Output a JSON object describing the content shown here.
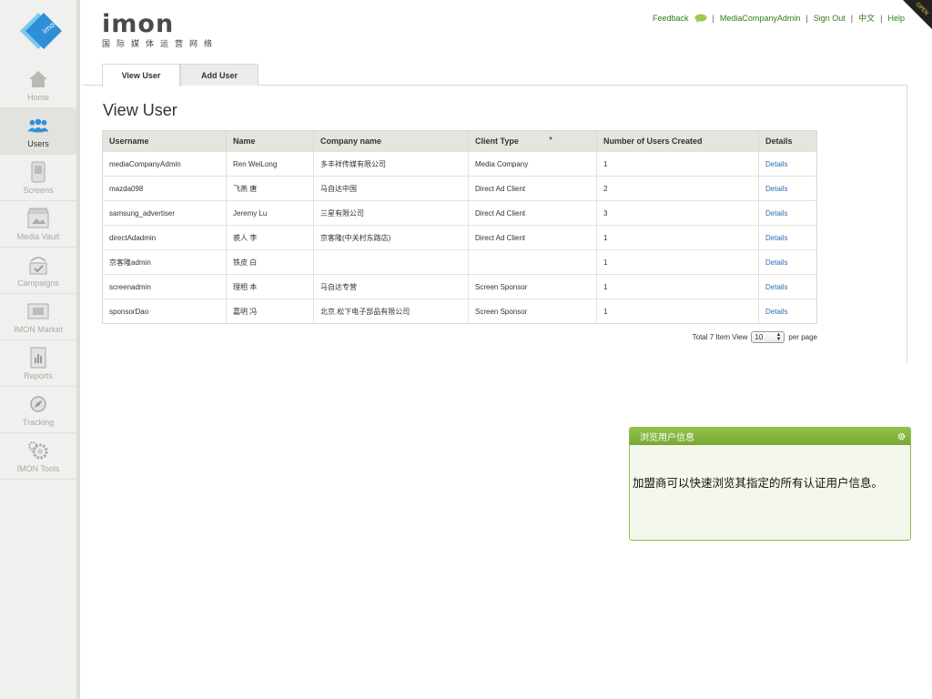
{
  "brand": {
    "name": "imon",
    "subtitle": "国际媒体运营网络"
  },
  "top_links": {
    "feedback": "Feedback",
    "user": "MediaCompanyAdmin",
    "sign_out": "Sign Out",
    "language": "中文",
    "help": "Help",
    "corner_badge": "OPEN"
  },
  "sidebar": {
    "items": [
      {
        "label": "Home",
        "icon": "home-icon"
      },
      {
        "label": "Users",
        "icon": "users-icon"
      },
      {
        "label": "Screens",
        "icon": "screen-icon"
      },
      {
        "label": "Media Vault",
        "icon": "media-vault-icon"
      },
      {
        "label": "Campaigns",
        "icon": "campaigns-icon"
      },
      {
        "label": "IMON Market",
        "icon": "market-icon"
      },
      {
        "label": "Reports",
        "icon": "reports-icon"
      },
      {
        "label": "Tracking",
        "icon": "tracking-icon"
      },
      {
        "label": "IMON Tools",
        "icon": "tools-icon"
      }
    ],
    "active": "Users"
  },
  "tabs": {
    "view_user": "View User",
    "add_user": "Add User",
    "active": "View User"
  },
  "page_title": "View User",
  "table": {
    "headers": [
      "Username",
      "Name",
      "Company name",
      "Client Type",
      "Number of Users Created",
      "Details"
    ],
    "rows": [
      [
        "mediaCompanyAdmin",
        "Ren  WeiLong",
        "多丰祥传媒有限公司",
        "Media Company",
        "1",
        "Details"
      ],
      [
        "mazda098",
        "飞燕  唐",
        "马自达中国",
        "Direct Ad Client",
        "2",
        "Details"
      ],
      [
        "samsung_advertiser",
        "Jeremy   Lu",
        "三星有限公司",
        "Direct Ad Client",
        "3",
        "Details"
      ],
      [
        "directAdadmin",
        "裘人  李",
        "京客隆(中关村东路店)",
        "Direct Ad Client",
        "1",
        "Details"
      ],
      [
        "京客隆admin",
        "铁皮  白",
        "",
        "",
        "1",
        "Details"
      ],
      [
        "screenadmin",
        "理相  本",
        "马自达专营",
        "Screen Sponsor",
        "1",
        "Details"
      ],
      [
        "sponsorDao",
        "嘉明  冯",
        "北京.松下电子部品有限公司",
        "Screen Sponsor",
        "1",
        "Details"
      ]
    ]
  },
  "pager": {
    "prefix": "Total 7 Item View",
    "per_page_value": "10",
    "suffix": "per page"
  },
  "infobox": {
    "title": "浏览用户信息",
    "body": "加盟商可以快速浏览其指定的所有认证用户信息。"
  },
  "colors": {
    "accent_green": "#7fb03a",
    "link_blue": "#2a6fb5",
    "top_link_green": "#2f7a1b"
  }
}
